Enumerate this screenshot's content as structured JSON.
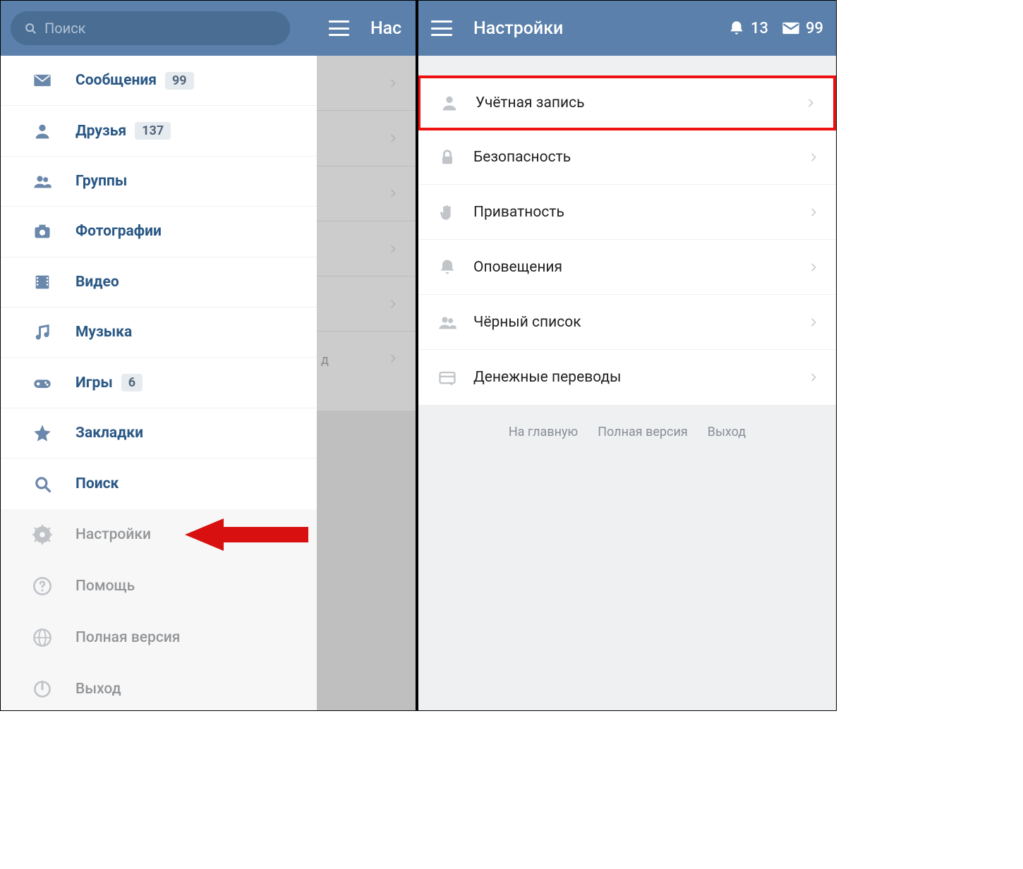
{
  "left": {
    "search_placeholder": "Поиск",
    "header_title_clipped": "Нас",
    "menu_primary": [
      {
        "id": "messages",
        "label": "Сообщения",
        "badge": "99",
        "icon": "mail-icon"
      },
      {
        "id": "friends",
        "label": "Друзья",
        "badge": "137",
        "icon": "person-icon"
      },
      {
        "id": "groups",
        "label": "Группы",
        "badge": null,
        "icon": "people-icon"
      },
      {
        "id": "photos",
        "label": "Фотографии",
        "badge": null,
        "icon": "camera-icon"
      },
      {
        "id": "video",
        "label": "Видео",
        "badge": null,
        "icon": "film-icon"
      },
      {
        "id": "music",
        "label": "Музыка",
        "badge": null,
        "icon": "music-icon"
      },
      {
        "id": "games",
        "label": "Игры",
        "badge": "6",
        "icon": "gamepad-icon"
      },
      {
        "id": "bookmarks",
        "label": "Закладки",
        "badge": null,
        "icon": "star-icon"
      },
      {
        "id": "search",
        "label": "Поиск",
        "badge": null,
        "icon": "search-icon"
      }
    ],
    "menu_secondary": [
      {
        "id": "settings",
        "label": "Настройки",
        "icon": "gear-icon",
        "arrow": true
      },
      {
        "id": "help",
        "label": "Помощь",
        "icon": "help-icon"
      },
      {
        "id": "fullversion",
        "label": "Полная версия",
        "icon": "globe-icon"
      },
      {
        "id": "logout",
        "label": "Выход",
        "icon": "power-icon"
      }
    ],
    "bg_fragment": "д"
  },
  "right": {
    "header_title": "Настройки",
    "notification_count": "13",
    "mail_count": "99",
    "settings_items": [
      {
        "id": "account",
        "label": "Учётная запись",
        "icon": "person-icon",
        "highlight": true
      },
      {
        "id": "security",
        "label": "Безопасность",
        "icon": "lock-icon"
      },
      {
        "id": "privacy",
        "label": "Приватность",
        "icon": "hand-icon"
      },
      {
        "id": "notify",
        "label": "Оповещения",
        "icon": "bell-icon"
      },
      {
        "id": "blacklist",
        "label": "Чёрный список",
        "icon": "people-icon"
      },
      {
        "id": "payments",
        "label": "Денежные переводы",
        "icon": "card-icon"
      }
    ],
    "footer": {
      "home": "На главную",
      "full": "Полная версия",
      "logout": "Выход"
    }
  }
}
